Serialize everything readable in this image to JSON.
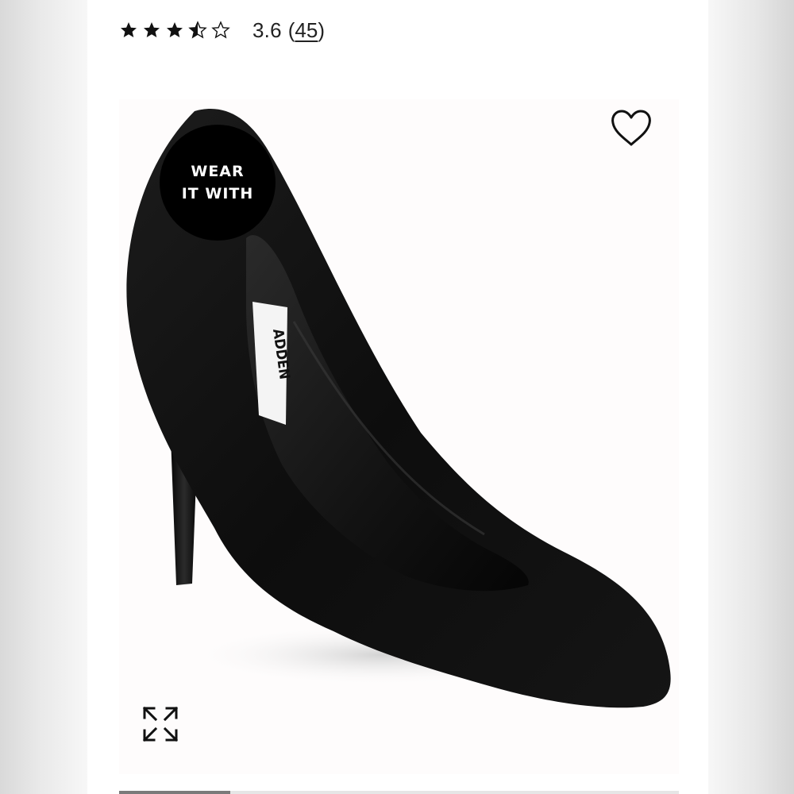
{
  "rating": {
    "stars_filled": 3.6,
    "stars_total": 5,
    "value": "3.6",
    "count_open": "(",
    "count": "45",
    "count_close": ")"
  },
  "product": {
    "wear_it_with": {
      "line1": "WEAR",
      "line2": "IT WITH"
    },
    "brand_label_visible": "ADDEN",
    "icons": {
      "favorite": "heart-icon",
      "expand": "expand-icon"
    }
  },
  "carousel": {
    "current_index": 1,
    "total": 5
  },
  "colors": {
    "star": "#111111",
    "badge_bg": "#000000",
    "badge_text": "#ffffff",
    "image_bg": "#fefcfc"
  }
}
